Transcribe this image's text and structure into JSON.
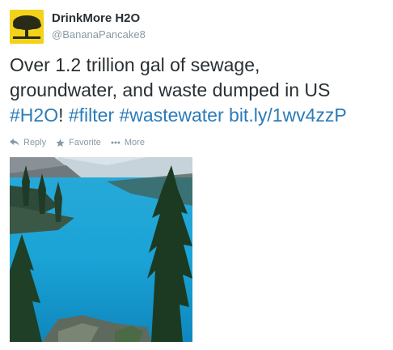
{
  "user": {
    "display_name": "DrinkMore H2O",
    "handle": "@BananaPancake8"
  },
  "tweet": {
    "text_line1": "Over 1.2 trillion gal of sewage,",
    "text_line2": "groundwater, and waste dumped in US",
    "hashtag_h2o": "#H2O",
    "bang": "!",
    "hashtag_filter": "#filter",
    "hashtag_wastewater": "#wastewater",
    "link": "bit.ly/1wv4zzP"
  },
  "actions": {
    "reply_label": "Reply",
    "favorite_label": "Favorite",
    "more_label": "More"
  },
  "colors": {
    "link": "#2b7bb9",
    "text": "#292f33",
    "muted": "#8899a6",
    "avatar_bg": "#f3d21a"
  },
  "icons": [
    "tree-logo-icon",
    "reply-icon",
    "star-icon",
    "more-dots-icon"
  ]
}
